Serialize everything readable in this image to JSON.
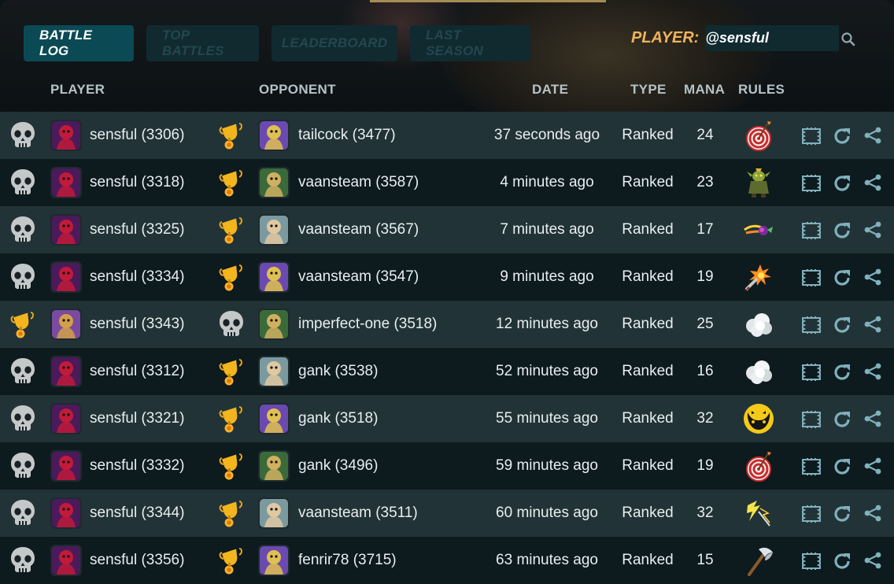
{
  "tabs": [
    "BATTLE LOG",
    "TOP BATTLES",
    "LEADERBOARD",
    "LAST SEASON"
  ],
  "player_filter": {
    "label": "PLAYER:",
    "value": "@sensful"
  },
  "columns": {
    "player": "PLAYER",
    "opponent": "OPPONENT",
    "date": "DATE",
    "type": "TYPE",
    "mana": "MANA",
    "rules": "RULES"
  },
  "colors": {
    "accent_tab": "#0b4a55",
    "label": "#f0b35a",
    "row_light": "#223337",
    "row_dark": "#0d1a1e",
    "action_icon": "#7fb1bd"
  },
  "battles": [
    {
      "player": "sensful (3306)",
      "player_result": "skull-icon",
      "opponent": "tailcock (3477)",
      "opponent_result": "trophy-icon",
      "date": "37 seconds ago",
      "type": "Ranked",
      "mana": "24",
      "rule_icon": "target-icon"
    },
    {
      "player": "sensful (3318)",
      "player_result": "skull-icon",
      "opponent": "vaansteam (3587)",
      "opponent_result": "trophy-icon",
      "date": "4 minutes ago",
      "type": "Ranked",
      "mana": "23",
      "rule_icon": "goblin-icon"
    },
    {
      "player": "sensful (3325)",
      "player_result": "skull-icon",
      "opponent": "vaansteam (3567)",
      "opponent_result": "trophy-icon",
      "date": "7 minutes ago",
      "type": "Ranked",
      "mana": "17",
      "rule_icon": "comet-icon"
    },
    {
      "player": "sensful (3334)",
      "player_result": "skull-icon",
      "opponent": "vaansteam (3547)",
      "opponent_result": "trophy-icon",
      "date": "9 minutes ago",
      "type": "Ranked",
      "mana": "19",
      "rule_icon": "blast-icon"
    },
    {
      "player": "sensful (3343)",
      "player_result": "trophy-icon",
      "opponent": "imperfect-one (3518)",
      "opponent_result": "skull-icon",
      "date": "12 minutes ago",
      "type": "Ranked",
      "mana": "25",
      "rule_icon": "cloud-icon"
    },
    {
      "player": "sensful (3312)",
      "player_result": "skull-icon",
      "opponent": "gank (3538)",
      "opponent_result": "trophy-icon",
      "date": "52 minutes ago",
      "type": "Ranked",
      "mana": "16",
      "rule_icon": "cloud-icon"
    },
    {
      "player": "sensful (3321)",
      "player_result": "skull-icon",
      "opponent": "gank (3518)",
      "opponent_result": "trophy-icon",
      "date": "55 minutes ago",
      "type": "Ranked",
      "mana": "32",
      "rule_icon": "monster-icon"
    },
    {
      "player": "sensful (3332)",
      "player_result": "skull-icon",
      "opponent": "gank (3496)",
      "opponent_result": "trophy-icon",
      "date": "59 minutes ago",
      "type": "Ranked",
      "mana": "19",
      "rule_icon": "target-icon"
    },
    {
      "player": "sensful (3344)",
      "player_result": "skull-icon",
      "opponent": "vaansteam (3511)",
      "opponent_result": "trophy-icon",
      "date": "60 minutes ago",
      "type": "Ranked",
      "mana": "32",
      "rule_icon": "lightning-icon"
    },
    {
      "player": "sensful (3356)",
      "player_result": "skull-icon",
      "opponent": "fenrir78 (3715)",
      "opponent_result": "trophy-icon",
      "date": "63 minutes ago",
      "type": "Ranked",
      "mana": "15",
      "rule_icon": "axe-icon"
    }
  ]
}
